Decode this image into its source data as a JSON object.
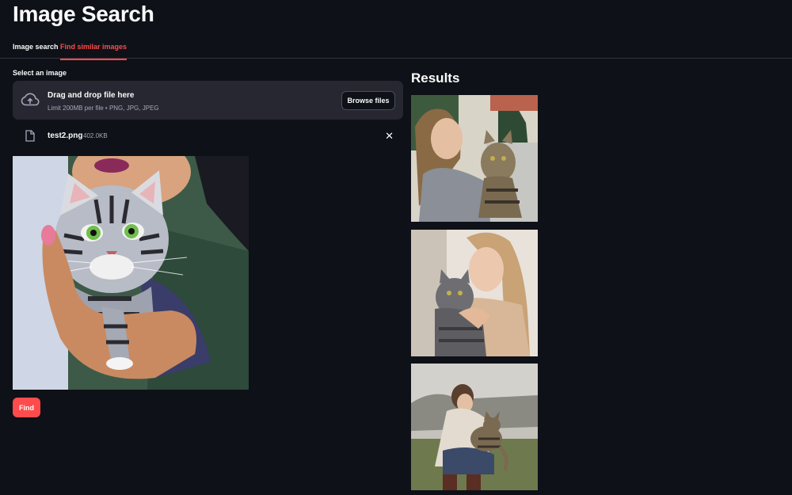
{
  "page": {
    "title": "Image Search"
  },
  "tabs": [
    {
      "label": "Image search",
      "active": false
    },
    {
      "label": "Find similar images",
      "active": true
    }
  ],
  "uploader": {
    "label": "Select an image",
    "drop_title": "Drag and drop file here",
    "drop_subtitle": "Limit 200MB per file • PNG, JPG, JPEG",
    "browse_label": "Browse files",
    "icon": "cloud-upload-icon"
  },
  "uploaded_file": {
    "name": "test2.png",
    "size": "402.0KB",
    "icon": "file-icon",
    "remove_icon": "close-icon",
    "remove_glyph": "✕"
  },
  "find_button": {
    "label": "Find"
  },
  "results": {
    "title": "Results"
  },
  "colors": {
    "background": "#0e1117",
    "surface": "#262730",
    "accent": "#ff4b4b",
    "text": "#fafafa",
    "muted": "#a3a8b8"
  }
}
